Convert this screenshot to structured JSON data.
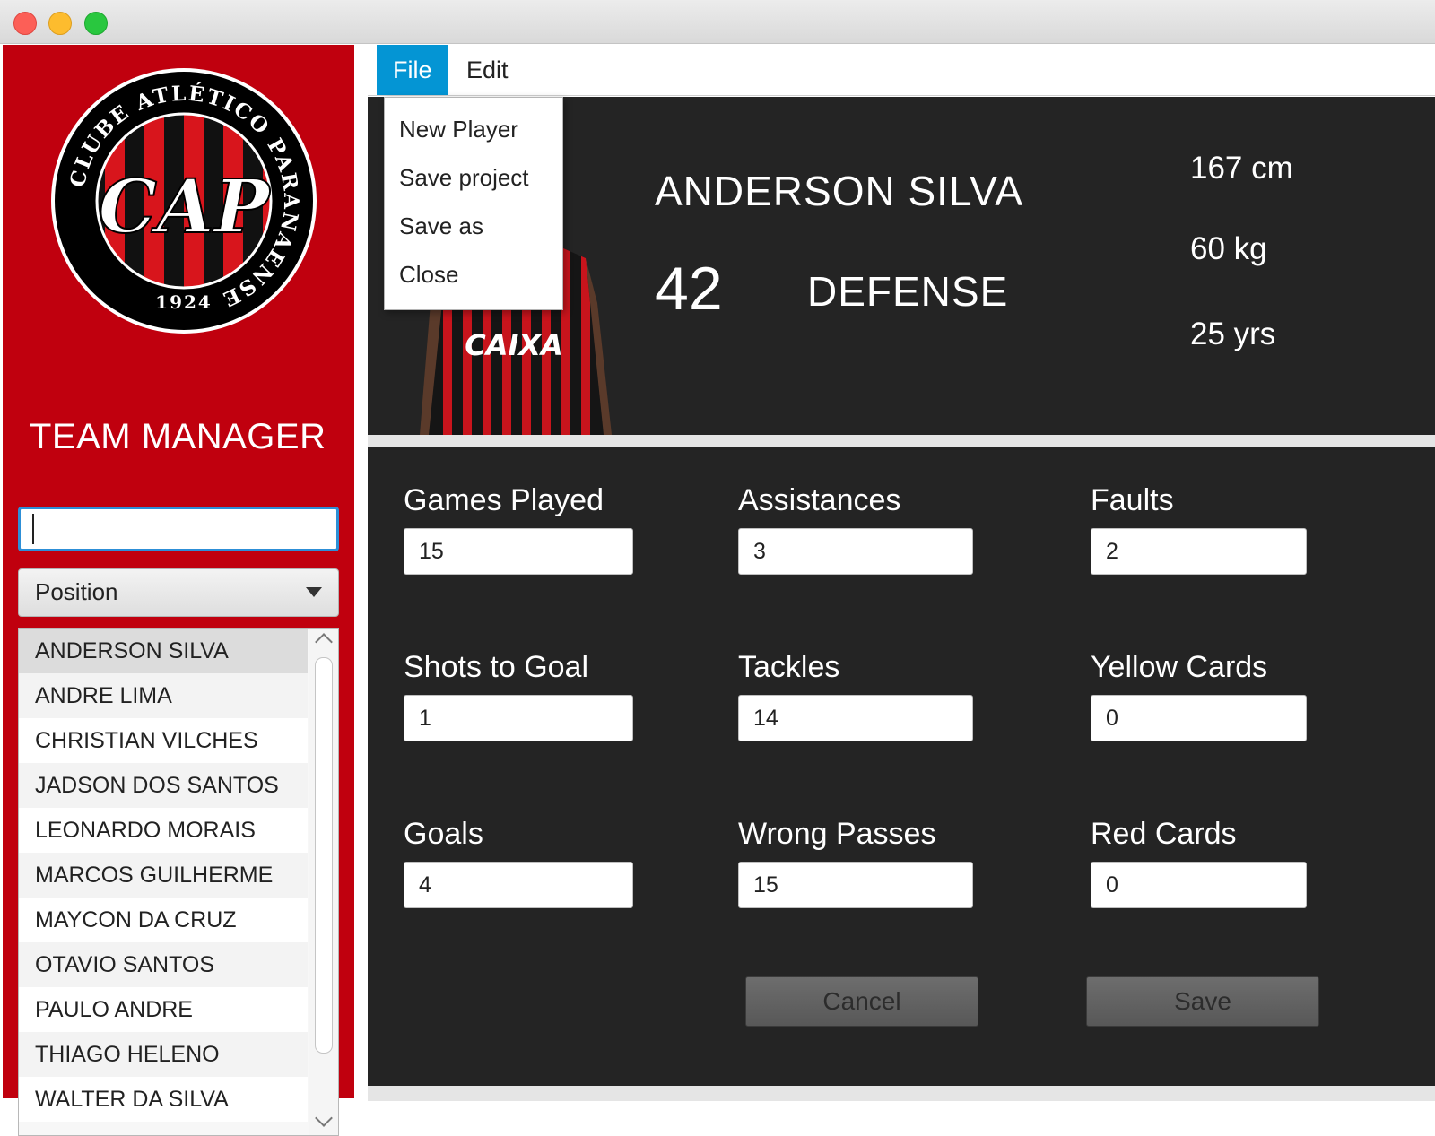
{
  "app": {
    "title": "TEAM MANAGER",
    "logo": {
      "ring_text": "CLUBE ATLÉTICO PARANAENSE",
      "monogram": "CAP",
      "year": "1924"
    },
    "colors": {
      "sidebar": "#c0000e",
      "accent": "#0495d4",
      "panel": "#242424"
    }
  },
  "sidebar": {
    "search": {
      "value": "",
      "placeholder": ""
    },
    "position_filter": {
      "selected": "Position"
    },
    "players": [
      "ANDERSON SILVA",
      "ANDRE LIMA",
      "CHRISTIAN VILCHES",
      "JADSON DOS SANTOS",
      "LEONARDO MORAIS",
      "MARCOS GUILHERME",
      "MAYCON DA CRUZ",
      "OTAVIO SANTOS",
      "PAULO ANDRE",
      "THIAGO HELENO",
      "WALTER DA SILVA"
    ],
    "selected_player": "ANDERSON SILVA"
  },
  "menubar": {
    "file": "File",
    "edit": "Edit",
    "file_menu": [
      "New Player",
      "Save project",
      "Save as",
      "Close"
    ]
  },
  "player": {
    "name": "ANDERSON SILVA",
    "number": "42",
    "position": "DEFENSE",
    "height": "167 cm",
    "weight": "60 kg",
    "age": "25 yrs",
    "shirt_sponsor": "CAIXA"
  },
  "stats": {
    "games_played": {
      "label": "Games Played",
      "value": "15"
    },
    "assistances": {
      "label": "Assistances",
      "value": "3"
    },
    "faults": {
      "label": "Faults",
      "value": "2"
    },
    "shots_to_goal": {
      "label": "Shots to Goal",
      "value": "1"
    },
    "tackles": {
      "label": "Tackles",
      "value": "14"
    },
    "yellow_cards": {
      "label": "Yellow Cards",
      "value": "0"
    },
    "goals": {
      "label": "Goals",
      "value": "4"
    },
    "wrong_passes": {
      "label": "Wrong Passes",
      "value": "15"
    },
    "red_cards": {
      "label": "Red Cards",
      "value": "0"
    }
  },
  "actions": {
    "cancel": "Cancel",
    "save": "Save"
  }
}
